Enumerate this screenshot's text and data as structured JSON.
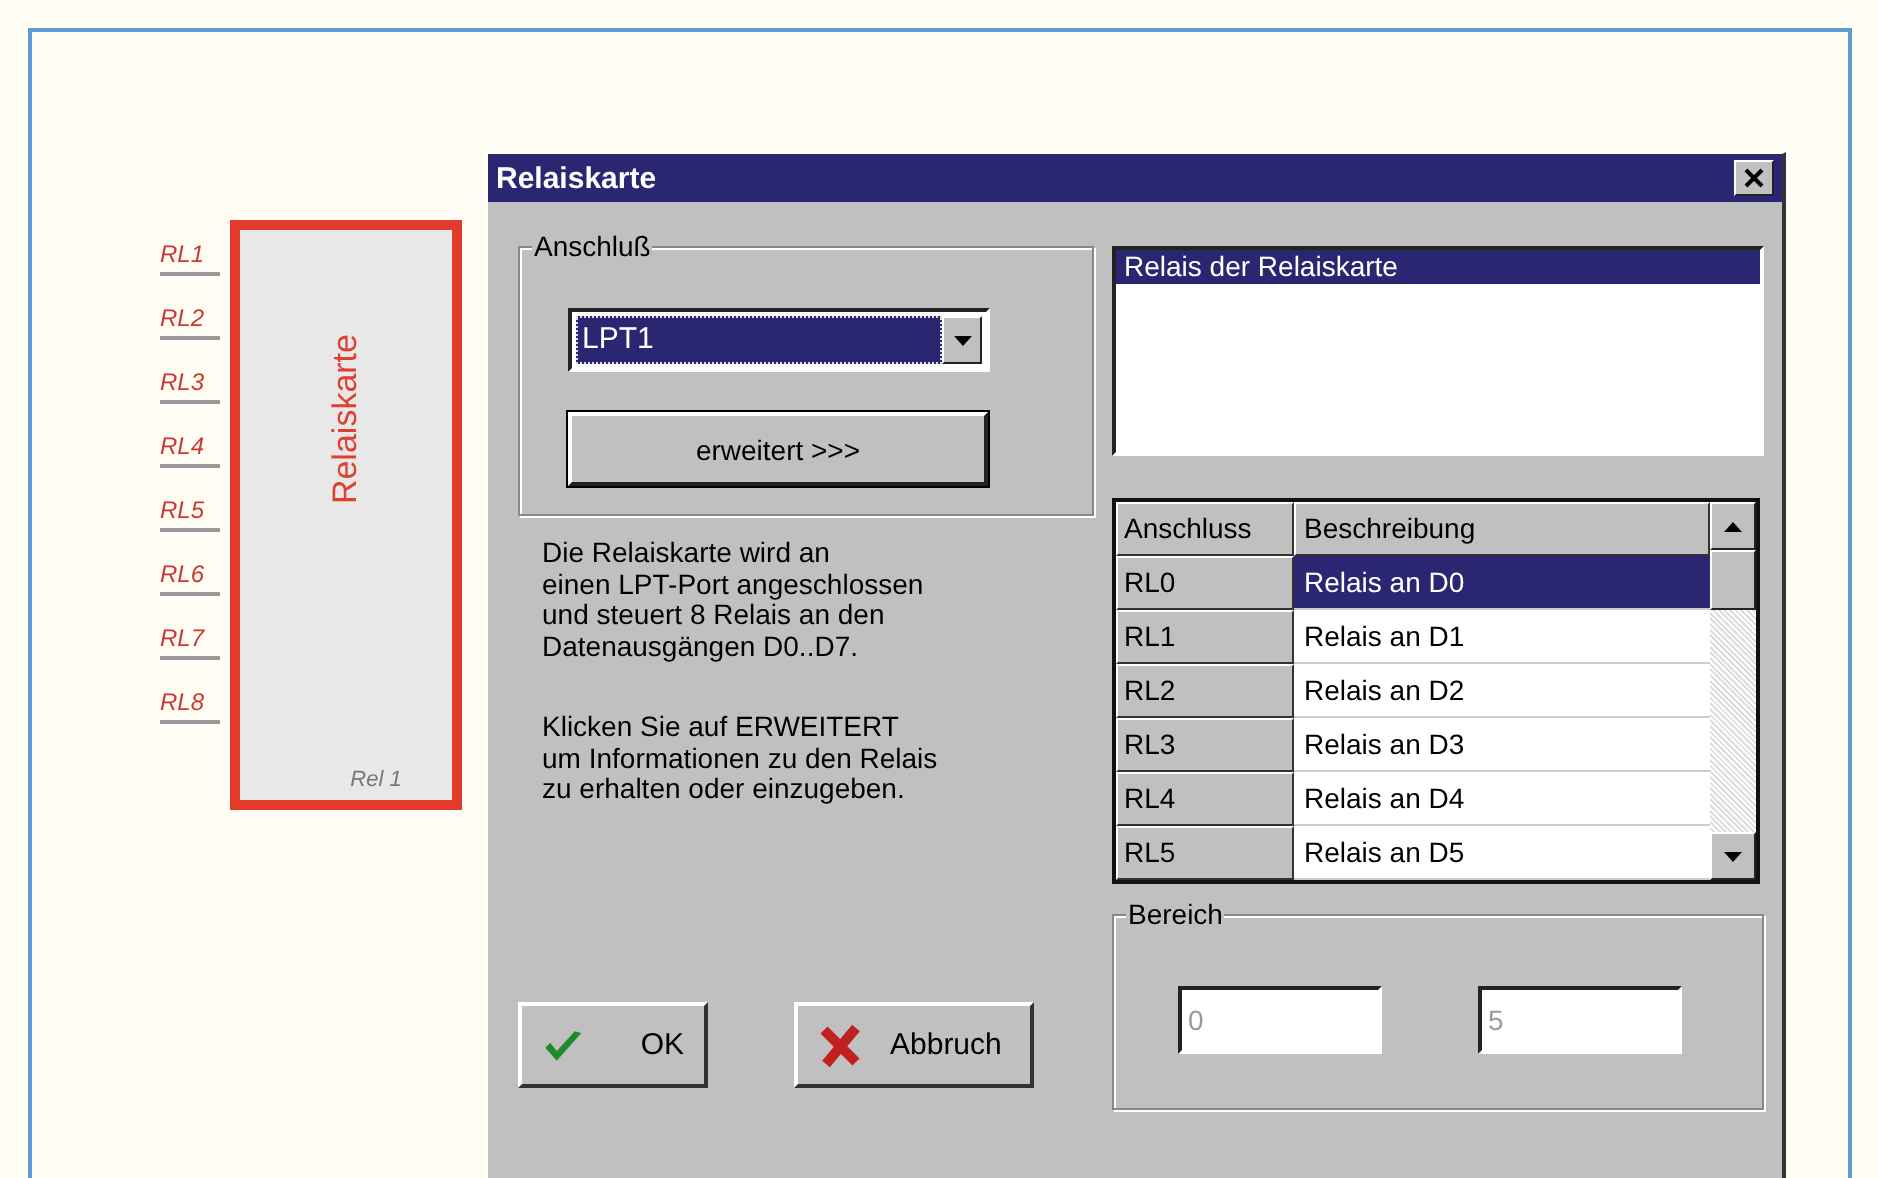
{
  "schematic": {
    "title": "Relaiskarte",
    "reference": "Rel 1",
    "pins": [
      "RL1",
      "RL2",
      "RL3",
      "RL4",
      "RL5",
      "RL6",
      "RL7",
      "RL8"
    ]
  },
  "dialog": {
    "title": "Relaiskarte",
    "connection_group": {
      "label": "Anschluß",
      "port": {
        "value": "LPT1"
      },
      "extended_button": "erweitert >>>"
    },
    "description": [
      "Die Relaiskarte wird an\neinen LPT-Port angeschlossen\nund steuert 8 Relais an den\nDatenausgängen D0..D7.",
      "Klicken Sie auf ERWEITERT\num Informationen zu den Relais\nzu erhalten oder einzugeben."
    ],
    "relay_list": {
      "items": [
        {
          "label": "Relais der Relaiskarte",
          "selected": true
        }
      ]
    },
    "table": {
      "columns": [
        "Anschluss",
        "Beschreibung"
      ],
      "rows": [
        {
          "port": "RL0",
          "description": "Relais an D0",
          "selected": true
        },
        {
          "port": "RL1",
          "description": "Relais an D1",
          "selected": false
        },
        {
          "port": "RL2",
          "description": "Relais an D2",
          "selected": false
        },
        {
          "port": "RL3",
          "description": "Relais an D3",
          "selected": false
        },
        {
          "port": "RL4",
          "description": "Relais an D4",
          "selected": false
        },
        {
          "port": "RL5",
          "description": "Relais an D5",
          "selected": false
        }
      ]
    },
    "range_group": {
      "label": "Bereich",
      "from": {
        "value": "0",
        "disabled": true
      },
      "to": {
        "value": "5",
        "disabled": true
      }
    },
    "buttons": [
      {
        "kind": "ok",
        "label": "OK"
      },
      {
        "kind": "cancel",
        "label": "Abbruch"
      }
    ]
  }
}
